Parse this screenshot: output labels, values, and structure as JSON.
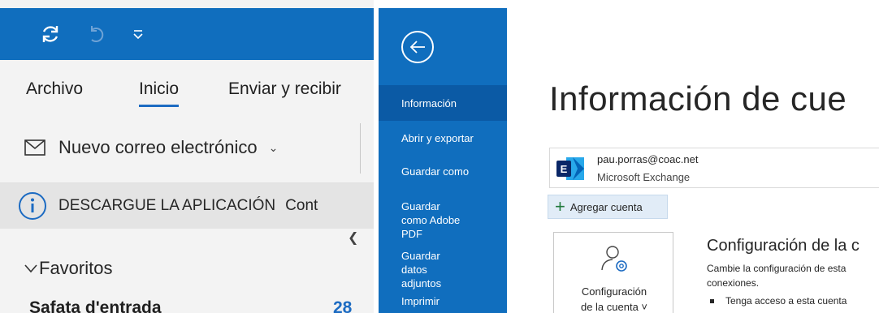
{
  "ribbon": {
    "tabs": [
      "Archivo",
      "Inicio",
      "Enviar y recibir"
    ],
    "new_mail_label": "Nuevo correo electrónico",
    "infobar_text": "DESCARGUE LA APLICACIÓN",
    "infobar_trailing": "Cont"
  },
  "folders": {
    "favorites_label": "Favoritos",
    "inbox_label": "Safata d'entrada",
    "inbox_count": "28"
  },
  "backstage": {
    "nav": [
      "Información",
      "Abrir y exportar",
      "Guardar como",
      "Guardar como Adobe PDF",
      "Guardar datos adjuntos",
      "Imprimir"
    ],
    "title": "Información de cue",
    "account": {
      "email": "pau.porras@coac.net",
      "type": "Microsoft Exchange"
    },
    "add_account_label": "Agregar cuenta",
    "settings_button": {
      "line1": "Configuración",
      "line2": "de la cuenta ˅"
    },
    "section_title": "Configuración de la c",
    "description_line1": "Cambie la configuración de esta",
    "description_line2": "conexiones.",
    "bullet1": "Tenga acceso a esta cuenta"
  },
  "colors": {
    "accent": "#106ebe",
    "nav_active": "#0b5aa5",
    "ribbon_bg": "#f3f3f3",
    "infobar_bg": "#e4e4e4",
    "underline": "#1c6bc2"
  },
  "icons": [
    "sync-icon",
    "undo-icon",
    "customize-qat-icon",
    "mail-icon",
    "chevron-down-icon",
    "info-icon",
    "collapse-icon",
    "back-arrow-icon",
    "exchange-logo-icon",
    "plus-icon",
    "account-settings-icon"
  ]
}
